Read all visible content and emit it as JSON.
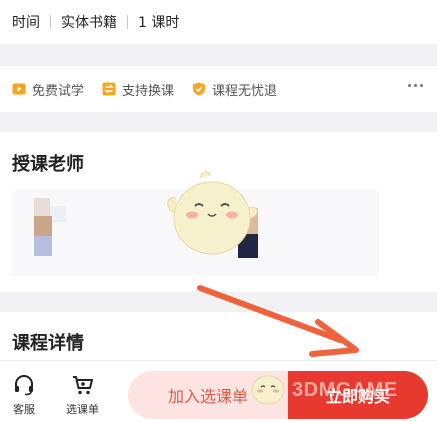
{
  "meta": {
    "items": [
      "时间",
      "实体书籍",
      "1 课时"
    ]
  },
  "guarantees": {
    "items": [
      {
        "label": "免费试学",
        "icon": "play-icon",
        "color": "#f5a623"
      },
      {
        "label": "支持换课",
        "icon": "swap-icon",
        "color": "#f5a623"
      },
      {
        "label": "课程无忧退",
        "icon": "shield-icon",
        "color": "#f5a623"
      }
    ],
    "more_icon": "more-dots-icon"
  },
  "teachers": {
    "title": "授课老师"
  },
  "detail": {
    "title": "课程详情"
  },
  "bottombar": {
    "service_label": "客服",
    "service_icon": "headset-icon",
    "cart_label": "选课单",
    "cart_icon": "cart-icon",
    "add_label": "加入选课单",
    "buy_label": "立即购买"
  },
  "colors": {
    "accent": "#e63a2f",
    "accent_light": "#fde4e2",
    "arrow": "#f0623b"
  },
  "watermark": {
    "text": "3DMGAME",
    "logo": "mascot-logo"
  }
}
